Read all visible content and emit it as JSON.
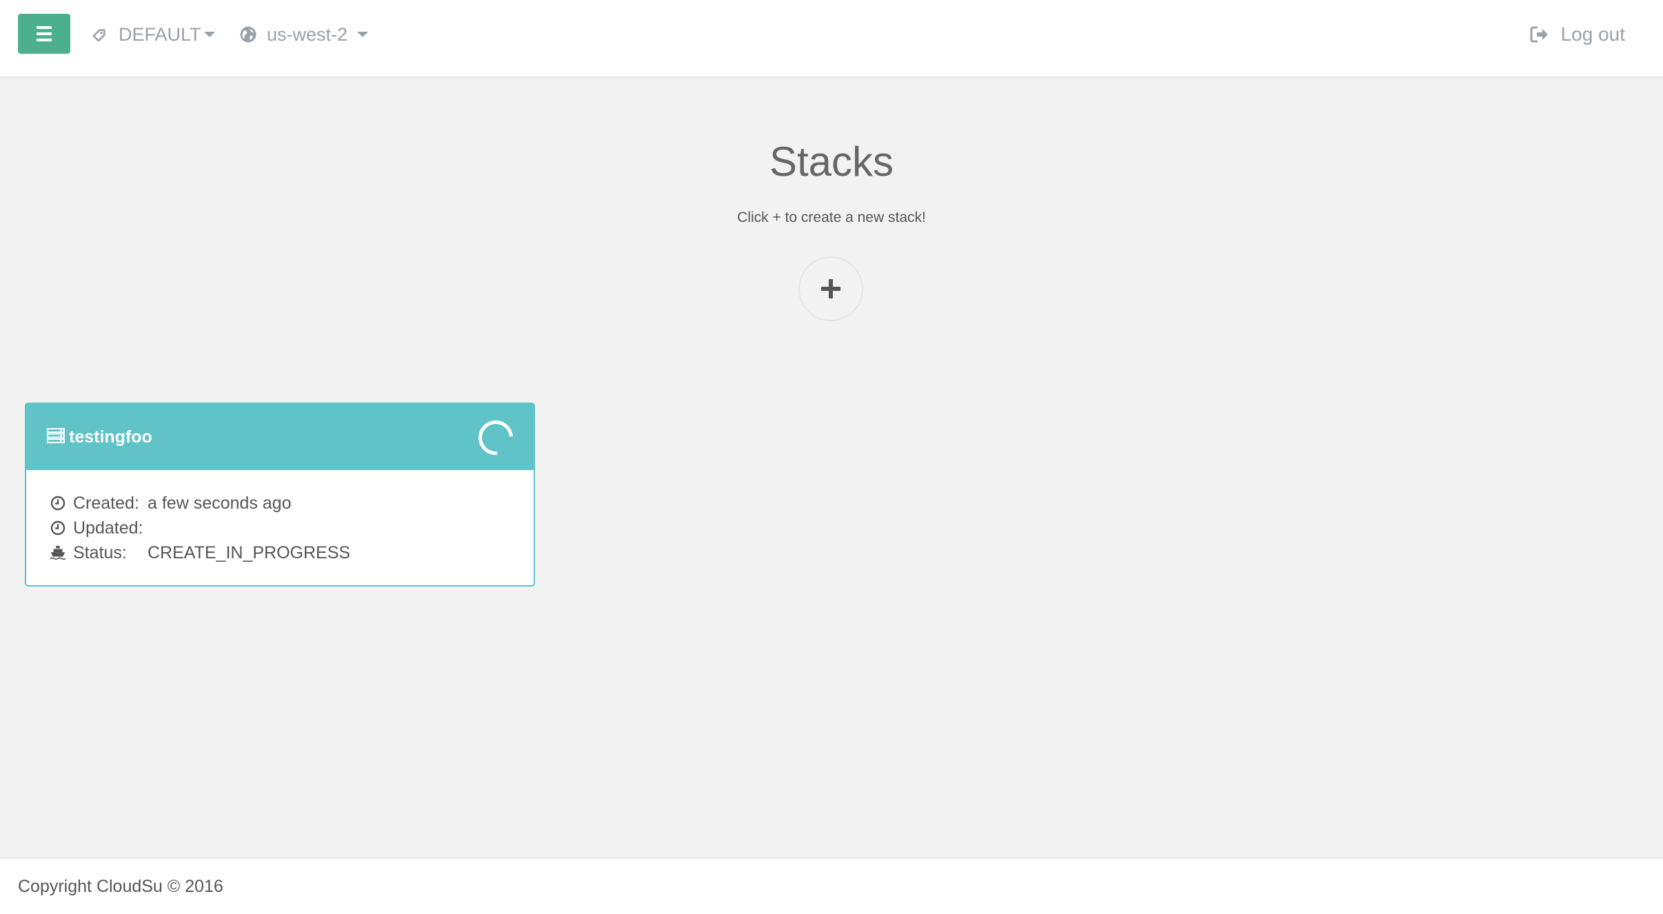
{
  "navbar": {
    "menu_icon": "hamburger-icon",
    "profile": {
      "icon": "tag-icon",
      "label": "DEFAULT"
    },
    "region": {
      "icon": "globe-icon",
      "label": "us-west-2"
    },
    "logout": {
      "icon": "sign-out-icon",
      "label": "Log out"
    }
  },
  "main": {
    "title": "Stacks",
    "subtitle": "Click + to create a new stack!",
    "add_icon": "plus-icon"
  },
  "stacks": [
    {
      "name": "testingfoo",
      "icon": "server-icon",
      "status_indicator": "spinner-icon",
      "created_label": "Created:",
      "created_value": "a few seconds ago",
      "updated_label": "Updated:",
      "updated_value": "",
      "status_label": "Status:",
      "status_value": "CREATE_IN_PROGRESS"
    }
  ],
  "footer": {
    "text": "Copyright CloudSu © 2016"
  },
  "colors": {
    "accent_green": "#4caf8d",
    "card_teal": "#5fc3c8",
    "background": "#f2f2f2",
    "nav_text": "#98a0a8"
  }
}
